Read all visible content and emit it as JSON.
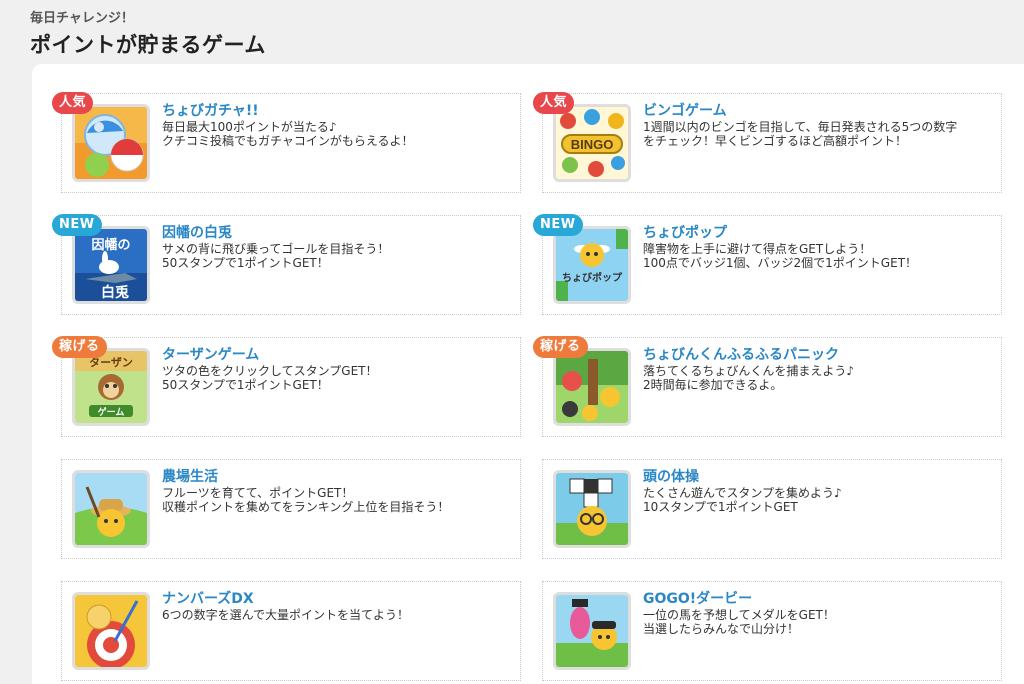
{
  "header": {
    "subtitle": "毎日チャレンジ！",
    "title": "ポイントが貯まるゲーム"
  },
  "colors": {
    "accent_blue": "#2a87c6",
    "badge_popular": "#e8474c",
    "badge_new": "#29a8d8",
    "badge_earn": "#ee7a3c"
  },
  "games": [
    {
      "name": "ちょびガチャ!!",
      "desc1": "毎日最大100ポイントが当たる♪",
      "desc2": "クチコミ投稿でもガチャコインがもらえるよ！",
      "badge": "人気",
      "thumb_icon": "capsule-toy-icon"
    },
    {
      "name": "ビンゴゲーム",
      "desc1": "1週間以内のビンゴを目指して、毎日発表される5つの数字",
      "desc2": "をチェック！早くビンゴするほど高額ポイント！",
      "badge": "人気",
      "thumb_icon": "bingo-icon",
      "thumb_text": "BINGO"
    },
    {
      "name": "因幡の白兎",
      "desc1": "サメの背に飛び乗ってゴールを目指そう！",
      "desc2": "50スタンプで1ポイントGET！",
      "badge": "NEW",
      "thumb_icon": "white-rabbit-icon",
      "thumb_text1": "因幡の",
      "thumb_text2": "白兎"
    },
    {
      "name": "ちょびポップ",
      "desc1": "障害物を上手に避けて得点をGETしよう！",
      "desc2": "100点でバッジ1個、バッジ2個で1ポイントGET！",
      "badge": "NEW",
      "thumb_icon": "chobi-pop-icon",
      "thumb_text": "ちょびポップ"
    },
    {
      "name": "ターザンゲーム",
      "desc1": "ツタの色をクリックしてスタンプGET！",
      "desc2": "50スタンプで1ポイントGET！",
      "badge": "稼げる",
      "thumb_icon": "tarzan-monkey-icon",
      "thumb_text1": "ターザン",
      "thumb_text2": "ゲーム"
    },
    {
      "name": "ちょびんくんふるふるパニック",
      "desc1": "落ちてくるちょびんくんを捕まえよう♪",
      "desc2": "2時間毎に参加できるよ。",
      "badge": "稼げる",
      "thumb_icon": "forest-panic-icon"
    },
    {
      "name": "農場生活",
      "desc1": "フルーツを育てて、ポイントGET！",
      "desc2": "収穫ポイントを集めてをランキング上位を目指そう！",
      "badge": "",
      "thumb_icon": "farm-life-icon"
    },
    {
      "name": "頭の体操",
      "desc1": "たくさん遊んでスタンプを集めよう♪",
      "desc2": "10スタンプで1ポイントGET",
      "badge": "",
      "thumb_icon": "brain-puzzle-icon"
    },
    {
      "name": "ナンバーズDX",
      "desc1": "6つの数字を選んで大量ポイントを当てよう！",
      "desc2": "",
      "badge": "",
      "thumb_icon": "numbers-dart-icon"
    },
    {
      "name": "GOGO!ダービー",
      "desc1": "一位の馬を予想してメダルをGET！",
      "desc2": "当選したらみんなで山分け！",
      "badge": "",
      "thumb_icon": "derby-horse-icon"
    }
  ]
}
